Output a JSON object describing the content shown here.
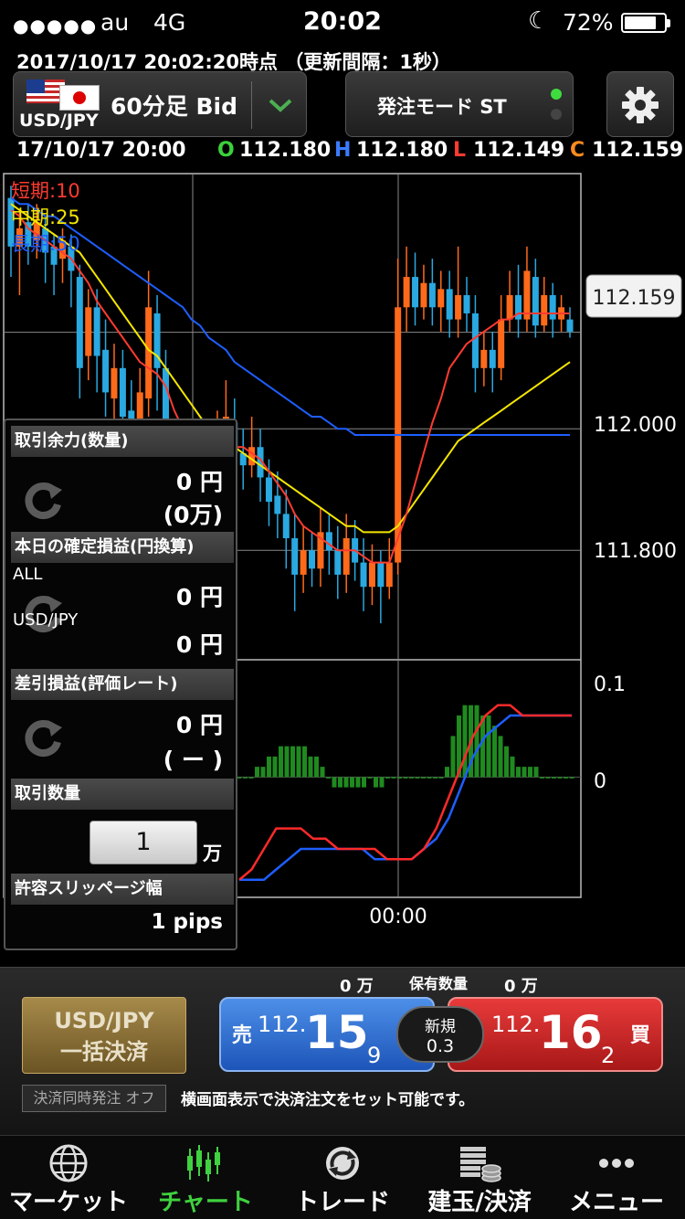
{
  "status_bar": {
    "signal": "●●●●●",
    "carrier": "au",
    "network": "4G",
    "time": "20:02",
    "battery": "72%"
  },
  "update_info": "2017/10/17  20:02:20時点 （更新間隔：1秒）",
  "pair_selector": {
    "pair": "USD/JPY",
    "timeframe": "60分足 Bid",
    "chevron_icon": "chevron-down-icon"
  },
  "mode_button": {
    "label": "発注モード ST"
  },
  "settings_icon": "gear-icon",
  "ohlc": {
    "datetime": "17/10/17 20:00",
    "o_label": "O",
    "o_value": "112.180",
    "h_label": "H",
    "h_value": "112.180",
    "l_label": "L",
    "l_value": "112.149",
    "c_label": "C",
    "c_value": "112.159"
  },
  "chart_data": {
    "type": "line",
    "title": "",
    "legend": [
      {
        "name": "短期:10",
        "color": "#ff3b30"
      },
      {
        "name": "中期:25",
        "color": "#f5e600"
      },
      {
        "name": "長期:50",
        "color": "#1e5eff"
      }
    ],
    "price_ticks": [
      "112.159",
      "112.000",
      "111.800"
    ],
    "current_price": "112.159",
    "ylim": [
      111.62,
      112.42
    ],
    "osc_ticks": [
      "0.1",
      "0"
    ],
    "x_tick": "00:00",
    "candles": [
      [
        112.38,
        112.3,
        112.4,
        112.25
      ],
      [
        112.3,
        112.33,
        112.36,
        112.22
      ],
      [
        112.34,
        112.3,
        112.37,
        112.27
      ],
      [
        112.31,
        112.34,
        112.37,
        112.28
      ],
      [
        112.33,
        112.29,
        112.35,
        112.24
      ],
      [
        112.3,
        112.27,
        112.32,
        112.22
      ],
      [
        112.28,
        112.31,
        112.33,
        112.24
      ],
      [
        112.3,
        112.26,
        112.32,
        112.2
      ],
      [
        112.25,
        112.1,
        112.27,
        112.05
      ],
      [
        112.12,
        112.2,
        112.23,
        112.08
      ],
      [
        112.2,
        112.12,
        112.23,
        112.06
      ],
      [
        112.13,
        112.06,
        112.18,
        112.02
      ],
      [
        112.05,
        112.1,
        112.14,
        112.01
      ],
      [
        112.1,
        112.02,
        112.13,
        111.98
      ],
      [
        112.03,
        112.0,
        112.08,
        111.95
      ],
      [
        112.0,
        112.06,
        112.1,
        111.96
      ],
      [
        112.05,
        112.2,
        112.26,
        112.02
      ],
      [
        112.19,
        112.1,
        112.22,
        112.03
      ],
      [
        112.1,
        111.95,
        112.13,
        111.88
      ],
      [
        111.96,
        111.89,
        112.0,
        111.83
      ],
      [
        111.9,
        111.86,
        111.94,
        111.8
      ],
      [
        111.88,
        111.92,
        111.96,
        111.84
      ],
      [
        111.92,
        111.87,
        111.95,
        111.82
      ],
      [
        111.88,
        111.84,
        111.92,
        111.79
      ],
      [
        111.85,
        111.95,
        112.03,
        111.83
      ],
      [
        111.95,
        112.02,
        112.08,
        111.92
      ],
      [
        112.01,
        111.96,
        112.05,
        111.93
      ],
      [
        111.96,
        111.94,
        112.0,
        111.9
      ],
      [
        111.94,
        111.97,
        112.02,
        111.92
      ],
      [
        111.97,
        111.92,
        112.0,
        111.88
      ],
      [
        111.92,
        111.88,
        111.95,
        111.84
      ],
      [
        111.89,
        111.86,
        111.93,
        111.82
      ],
      [
        111.86,
        111.82,
        111.9,
        111.77
      ],
      [
        111.82,
        111.76,
        111.86,
        111.7
      ],
      [
        111.76,
        111.8,
        111.84,
        111.73
      ],
      [
        111.8,
        111.77,
        111.83,
        111.74
      ],
      [
        111.77,
        111.83,
        111.87,
        111.74
      ],
      [
        111.83,
        111.8,
        111.86,
        111.76
      ],
      [
        111.8,
        111.76,
        111.84,
        111.72
      ],
      [
        111.76,
        111.82,
        111.86,
        111.73
      ],
      [
        111.82,
        111.78,
        111.85,
        111.75
      ],
      [
        111.78,
        111.74,
        111.82,
        111.7
      ],
      [
        111.74,
        111.78,
        111.81,
        111.71
      ],
      [
        111.78,
        111.74,
        111.8,
        111.68
      ],
      [
        111.74,
        111.78,
        111.82,
        111.72
      ],
      [
        111.78,
        112.2,
        112.28,
        111.76
      ],
      [
        112.2,
        112.25,
        112.3,
        112.16
      ],
      [
        112.25,
        112.2,
        112.29,
        112.17
      ],
      [
        112.2,
        112.24,
        112.27,
        112.18
      ],
      [
        112.24,
        112.2,
        112.28,
        112.17
      ],
      [
        112.2,
        112.23,
        112.26,
        112.16
      ],
      [
        112.23,
        112.18,
        112.26,
        112.15
      ],
      [
        112.18,
        112.22,
        112.3,
        112.15
      ],
      [
        112.22,
        112.19,
        112.25,
        112.16
      ],
      [
        112.19,
        112.1,
        112.22,
        112.06
      ],
      [
        112.1,
        112.13,
        112.16,
        112.07
      ],
      [
        112.13,
        112.1,
        112.16,
        112.06
      ],
      [
        112.1,
        112.18,
        112.22,
        112.08
      ],
      [
        112.18,
        112.22,
        112.26,
        112.16
      ],
      [
        112.22,
        112.18,
        112.27,
        112.15
      ],
      [
        112.18,
        112.26,
        112.3,
        112.16
      ],
      [
        112.25,
        112.17,
        112.28,
        112.15
      ],
      [
        112.17,
        112.22,
        112.25,
        112.16
      ],
      [
        112.22,
        112.18,
        112.24,
        112.15
      ],
      [
        112.18,
        112.2,
        112.22,
        112.16
      ],
      [
        112.18,
        112.16,
        112.2,
        112.15
      ]
    ],
    "ma_short": [
      112.36,
      112.35,
      112.33,
      112.32,
      112.31,
      112.3,
      112.29,
      112.28,
      112.26,
      112.24,
      112.21,
      112.19,
      112.17,
      112.15,
      112.13,
      112.11,
      112.1,
      112.09,
      112.07,
      112.03,
      112.0,
      111.98,
      111.96,
      111.95,
      111.95,
      111.96,
      111.97,
      111.97,
      111.96,
      111.95,
      111.93,
      111.91,
      111.89,
      111.86,
      111.84,
      111.83,
      111.82,
      111.81,
      111.8,
      111.8,
      111.8,
      111.79,
      111.78,
      111.78,
      111.78,
      111.82,
      111.86,
      111.91,
      111.96,
      112.01,
      112.05,
      112.1,
      112.12,
      112.14,
      112.15,
      112.16,
      112.17,
      112.18,
      112.18,
      112.19,
      112.19,
      112.19,
      112.19,
      112.19,
      112.19,
      112.19
    ],
    "ma_mid": [
      112.37,
      112.36,
      112.35,
      112.34,
      112.33,
      112.32,
      112.31,
      112.3,
      112.29,
      112.27,
      112.25,
      112.23,
      112.21,
      112.19,
      112.17,
      112.15,
      112.13,
      112.12,
      112.1,
      112.08,
      112.06,
      112.04,
      112.02,
      112.0,
      111.99,
      111.98,
      111.97,
      111.96,
      111.95,
      111.94,
      111.93,
      111.92,
      111.91,
      111.9,
      111.89,
      111.88,
      111.87,
      111.86,
      111.85,
      111.84,
      111.84,
      111.83,
      111.83,
      111.83,
      111.83,
      111.84,
      111.86,
      111.88,
      111.9,
      111.92,
      111.94,
      111.96,
      111.98,
      111.99,
      112.0,
      112.01,
      112.02,
      112.03,
      112.04,
      112.05,
      112.06,
      112.07,
      112.08,
      112.09,
      112.1,
      112.11
    ],
    "ma_long": [
      112.38,
      112.37,
      112.37,
      112.36,
      112.35,
      112.35,
      112.34,
      112.33,
      112.32,
      112.31,
      112.3,
      112.29,
      112.28,
      112.27,
      112.26,
      112.25,
      112.24,
      112.23,
      112.22,
      112.21,
      112.2,
      112.18,
      112.17,
      112.15,
      112.14,
      112.13,
      112.11,
      112.1,
      112.09,
      112.08,
      112.07,
      112.06,
      112.05,
      112.04,
      112.03,
      112.02,
      112.02,
      112.01,
      112.0,
      112.0,
      111.99,
      111.99,
      111.99,
      111.99,
      111.99,
      111.99,
      111.99,
      111.99,
      111.99,
      111.99,
      111.99,
      111.99,
      111.99,
      111.99,
      111.99,
      111.99,
      111.99,
      111.99,
      111.99,
      111.99,
      111.99,
      111.99,
      111.99,
      111.99,
      111.99,
      111.99
    ],
    "osc_hist": [
      0.0,
      0.0,
      0.0,
      0.01,
      0.01,
      0.02,
      0.02,
      0.03,
      0.03,
      0.03,
      0.03,
      0.03,
      0.02,
      0.02,
      0.01,
      0.0,
      -0.01,
      -0.01,
      -0.01,
      -0.01,
      -0.01,
      -0.01,
      0.0,
      -0.01,
      -0.01,
      0.0,
      0.0,
      0.0,
      0.0,
      0.0,
      0.0,
      0.0,
      0.0,
      0.0,
      0.0,
      0.01,
      0.04,
      0.06,
      0.07,
      0.07,
      0.07,
      0.06,
      0.06,
      0.05,
      0.04,
      0.03,
      0.02,
      0.01,
      0.01,
      0.01,
      0.01,
      0.0,
      0.0,
      0.0,
      0.0,
      0.0,
      0.0
    ],
    "osc_fast": [
      -0.1,
      -0.09,
      -0.07,
      -0.05,
      -0.05,
      -0.05,
      -0.06,
      -0.06,
      -0.07,
      -0.07,
      -0.07,
      -0.07,
      -0.08,
      -0.08,
      -0.08,
      -0.07,
      -0.05,
      -0.02,
      0.01,
      0.04,
      0.06,
      0.07,
      0.07,
      0.06,
      0.06,
      0.06,
      0.06,
      0.06
    ],
    "osc_slow": [
      -0.1,
      -0.1,
      -0.1,
      -0.09,
      -0.08,
      -0.07,
      -0.07,
      -0.07,
      -0.07,
      -0.07,
      -0.07,
      -0.08,
      -0.08,
      -0.08,
      -0.08,
      -0.07,
      -0.06,
      -0.04,
      -0.01,
      0.02,
      0.04,
      0.05,
      0.06,
      0.06,
      0.06,
      0.06,
      0.06,
      0.06
    ]
  },
  "panel": {
    "margin_title": "取引余力(数量)",
    "margin_yen": "0 円",
    "margin_units": "(0万)",
    "realized_title": "本日の確定損益(円換算)",
    "all_label": "ALL",
    "all_value": "0 円",
    "pair_label": "USD/JPY",
    "pair_value": "0 円",
    "unrealized_title": "差引損益(評価レート)",
    "unrealized_yen": "0 円",
    "unrealized_sub": "(  ー  )",
    "qty_title": "取引数量",
    "qty_value": "1",
    "qty_unit": "万",
    "slip_title": "許容スリッページ幅",
    "slip_value": "1 pips"
  },
  "trade": {
    "sell_qty": "0 万",
    "position_label": "保有数量",
    "buy_qty": "0 万",
    "settle_line1": "USD/JPY",
    "settle_line2": "一括決済",
    "sell_side": "売",
    "sell_prefix": "112.",
    "sell_big": "15",
    "sell_pip": "9",
    "spread_label": "新規",
    "spread_value": "0.3",
    "buy_side": "買",
    "buy_prefix": "112.",
    "buy_big": "16",
    "buy_pip": "2",
    "simul_order": "決済同時発注 オフ",
    "hint": "横画面表示で決済注文をセット可能です。",
    "sell_color": "#2b6fd6",
    "buy_color": "#d42424"
  },
  "tabs": [
    {
      "label": "マーケット",
      "icon": "globe-icon"
    },
    {
      "label": "チャート",
      "icon": "candlestick-icon"
    },
    {
      "label": "トレード",
      "icon": "trade-icon"
    },
    {
      "label": "建玉/決済",
      "icon": "coins-icon"
    },
    {
      "label": "メニュー",
      "icon": "more-icon"
    }
  ]
}
